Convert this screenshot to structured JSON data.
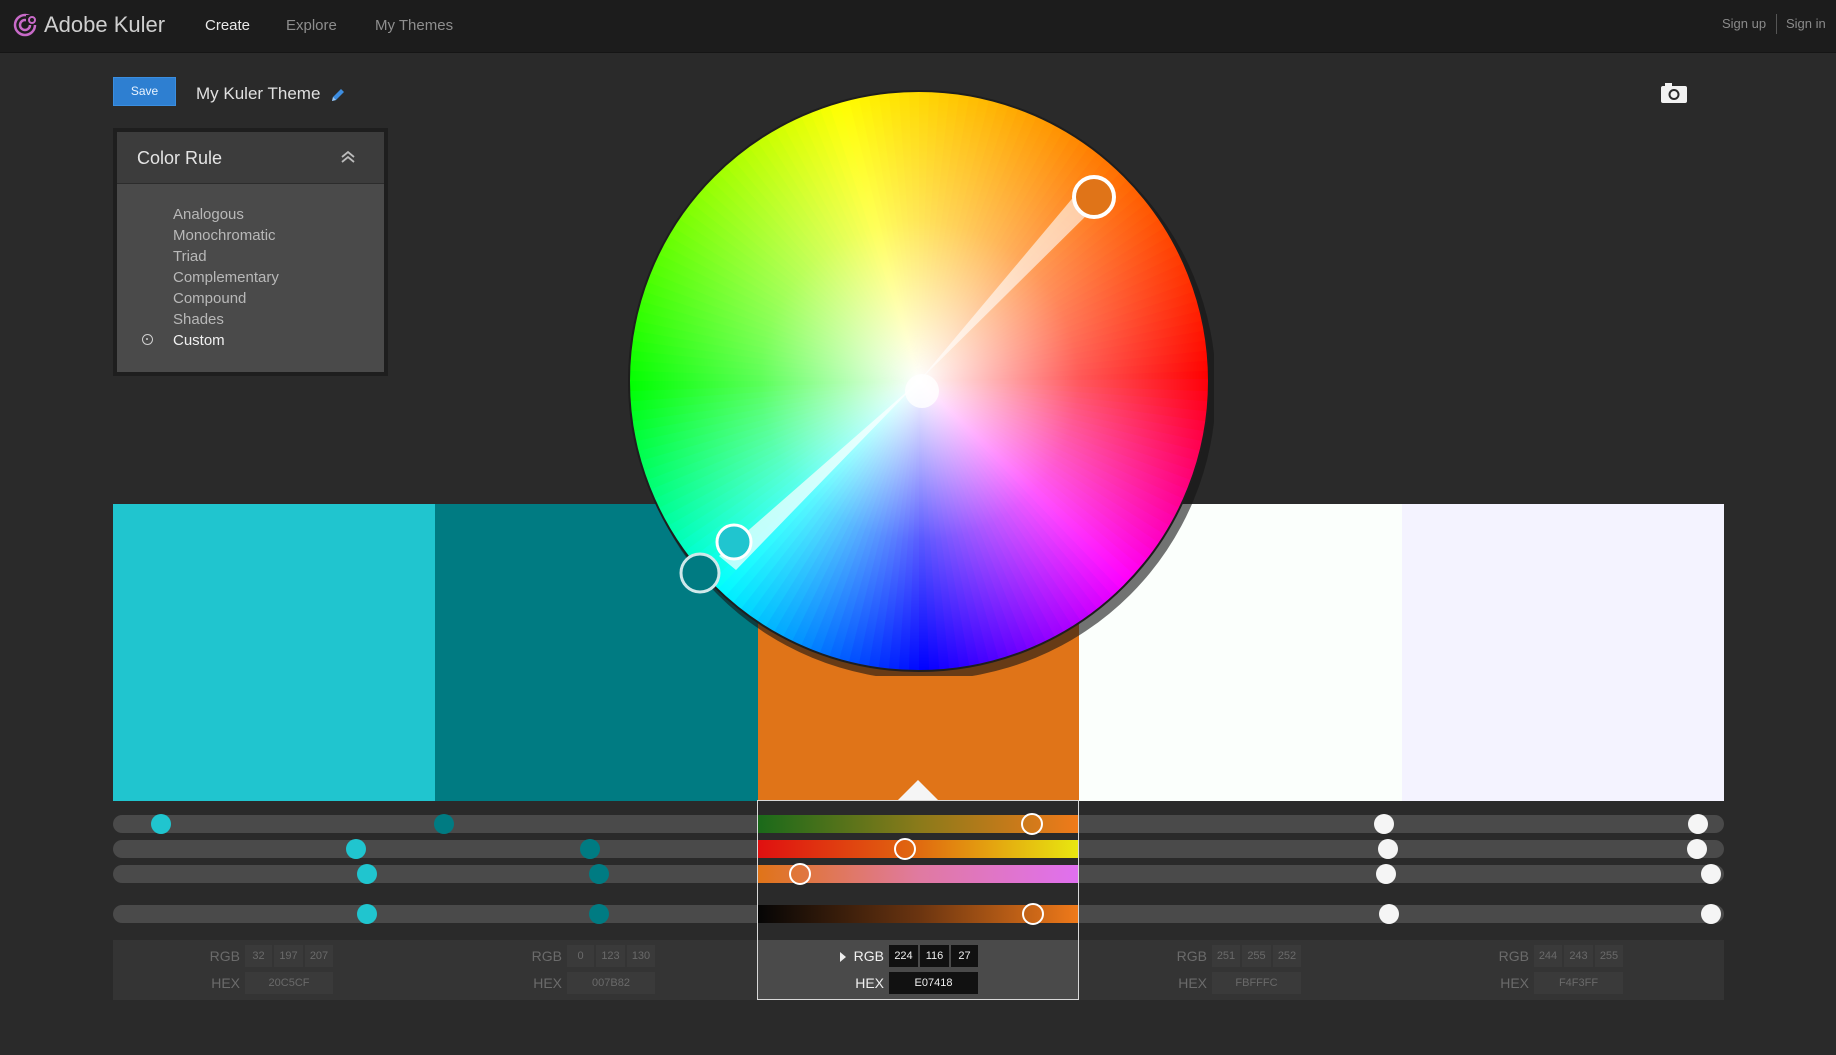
{
  "nav": {
    "brand": "Adobe Kuler",
    "items": [
      "Create",
      "Explore",
      "My Themes"
    ],
    "sign_up": "Sign up",
    "sign_in": "Sign in"
  },
  "header": {
    "save_label": "Save",
    "theme_title": "My Kuler Theme"
  },
  "color_rule": {
    "title": "Color Rule",
    "options": [
      "Analogous",
      "Monochromatic",
      "Triad",
      "Complementary",
      "Compound",
      "Shades",
      "Custom"
    ],
    "selected": "Custom"
  },
  "swatches": [
    {
      "color": "#20C5CF",
      "rgb": [
        "32",
        "197",
        "207"
      ],
      "hex": "20C5CF"
    },
    {
      "color": "#007B82",
      "rgb": [
        "0",
        "123",
        "130"
      ],
      "hex": "007B82"
    },
    {
      "color": "#E07418",
      "rgb": [
        "224",
        "116",
        "27"
      ],
      "hex": "E07418"
    },
    {
      "color": "#FBFFFC",
      "rgb": [
        "251",
        "255",
        "252"
      ],
      "hex": "FBFFFC"
    },
    {
      "color": "#F4F3FF",
      "rgb": [
        "244",
        "243",
        "255"
      ],
      "hex": "F4F3FF"
    }
  ],
  "labels": {
    "rgb": "RGB",
    "hex": "HEX"
  },
  "selected_swatch": 2,
  "icons": {
    "logo": "kuler-logo-icon",
    "edit": "pencil-icon",
    "camera": "camera-icon",
    "collapse": "chevron-double-up-icon",
    "expand_arrow": "triangle-right-icon"
  }
}
